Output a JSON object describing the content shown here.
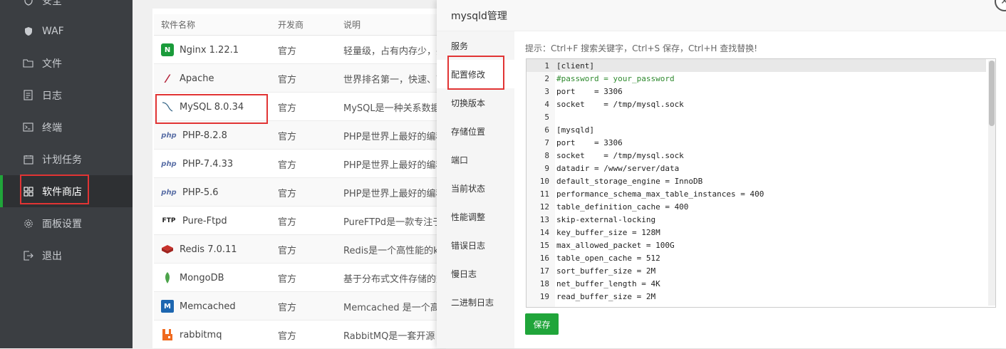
{
  "sidebar": {
    "items": [
      {
        "label": "安全",
        "icon": "shield-icon"
      },
      {
        "label": "WAF",
        "icon": "shield-solid-icon"
      },
      {
        "label": "文件",
        "icon": "folder-icon"
      },
      {
        "label": "日志",
        "icon": "log-icon"
      },
      {
        "label": "终端",
        "icon": "terminal-icon"
      },
      {
        "label": "计划任务",
        "icon": "calendar-icon"
      },
      {
        "label": "软件商店",
        "icon": "grid-icon",
        "active": true
      },
      {
        "label": "面板设置",
        "icon": "gear-icon"
      },
      {
        "label": "退出",
        "icon": "logout-icon"
      }
    ]
  },
  "software_table": {
    "headers": [
      "软件名称",
      "开发商",
      "说明"
    ],
    "rows": [
      {
        "name": "Nginx 1.22.1",
        "vendor": "官方",
        "desc": "轻量级，占有内存少，并",
        "icon": "nginx-icon"
      },
      {
        "name": "Apache",
        "vendor": "官方",
        "desc": "世界排名第一，快速、可",
        "icon": "apache-icon"
      },
      {
        "name": "MySQL 8.0.34",
        "vendor": "官方",
        "desc": "MySQL是一种关系数据库",
        "icon": "mysql-icon"
      },
      {
        "name": "PHP-8.2.8",
        "vendor": "官方",
        "desc": "PHP是世界上最好的编程",
        "icon": "php-icon"
      },
      {
        "name": "PHP-7.4.33",
        "vendor": "官方",
        "desc": "PHP是世界上最好的编程",
        "icon": "php-icon"
      },
      {
        "name": "PHP-5.6",
        "vendor": "官方",
        "desc": "PHP是世界上最好的编程",
        "icon": "php-icon"
      },
      {
        "name": "Pure-Ftpd",
        "vendor": "官方",
        "desc": "PureFTPd是一款专注于程",
        "icon": "ftp-icon"
      },
      {
        "name": "Redis 7.0.11",
        "vendor": "官方",
        "desc": "Redis是一个高性能的key",
        "icon": "redis-icon"
      },
      {
        "name": "MongoDB",
        "vendor": "官方",
        "desc": "基于分布式文件存储的数",
        "icon": "mongodb-icon"
      },
      {
        "name": "Memcached",
        "vendor": "官方",
        "desc": "Memcached 是一个高性",
        "icon": "memcached-icon"
      },
      {
        "name": "rabbitmq",
        "vendor": "官方",
        "desc": "RabbitMQ是一套开源（",
        "icon": "rabbitmq-icon"
      }
    ]
  },
  "modal": {
    "title": "mysqld管理",
    "close_icon": "close-icon",
    "nav": [
      {
        "label": "服务"
      },
      {
        "label": "配置修改",
        "active": true
      },
      {
        "label": "切换版本"
      },
      {
        "label": "存储位置"
      },
      {
        "label": "端口"
      },
      {
        "label": "当前状态"
      },
      {
        "label": "性能调整"
      },
      {
        "label": "错误日志"
      },
      {
        "label": "慢日志"
      },
      {
        "label": "二进制日志"
      }
    ],
    "tip": "提示：Ctrl+F 搜索关键字，Ctrl+S 保存，Ctrl+H 查找替换!",
    "save_label": "保存",
    "editor_lines": [
      {
        "n": "1",
        "text": "[client]"
      },
      {
        "n": "2",
        "text": "#password = your_password"
      },
      {
        "n": "3",
        "text": "port    = 3306"
      },
      {
        "n": "4",
        "text": "socket    = /tmp/mysql.sock"
      },
      {
        "n": "5",
        "text": ""
      },
      {
        "n": "6",
        "text": "[mysqld]"
      },
      {
        "n": "7",
        "text": "port    = 3306"
      },
      {
        "n": "8",
        "text": "socket    = /tmp/mysql.sock"
      },
      {
        "n": "9",
        "text": "datadir = /www/server/data"
      },
      {
        "n": "10",
        "text": "default_storage_engine = InnoDB"
      },
      {
        "n": "11",
        "text": "performance_schema_max_table_instances = 400"
      },
      {
        "n": "12",
        "text": "table_definition_cache = 400"
      },
      {
        "n": "13",
        "text": "skip-external-locking"
      },
      {
        "n": "14",
        "text": "key_buffer_size = 128M"
      },
      {
        "n": "15",
        "text": "max_allowed_packet = 100G"
      },
      {
        "n": "16",
        "text": "table_open_cache = 512"
      },
      {
        "n": "17",
        "text": "sort_buffer_size = 2M"
      },
      {
        "n": "18",
        "text": "net_buffer_length = 4K"
      },
      {
        "n": "19",
        "text": "read_buffer_size = 2M"
      }
    ]
  },
  "colors": {
    "sidebar_bg": "#3b3e42",
    "accent_green": "#20a53a",
    "highlight_red": "#e13434"
  }
}
